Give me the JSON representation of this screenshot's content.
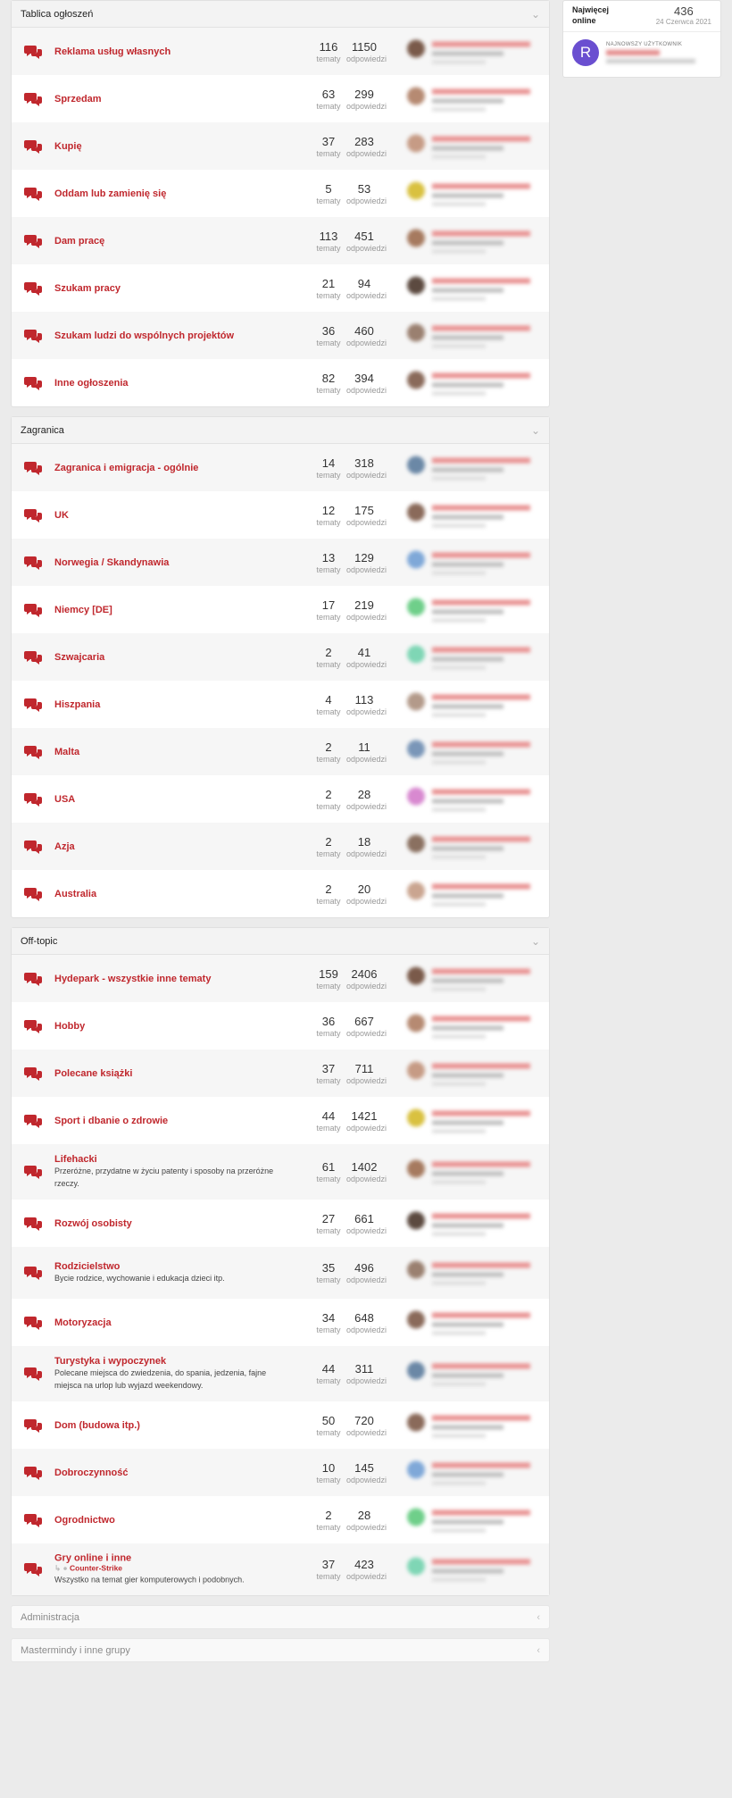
{
  "sidebar": {
    "online_label": "Najwięcej online",
    "online_count": "436",
    "online_date": "24 Czerwca 2021",
    "newest_label": "NAJNOWSZY UŻYTKOWNIK",
    "newest_initial": "R"
  },
  "labels": {
    "topics": "tematy",
    "replies": "odpowiedzi"
  },
  "categories": [
    {
      "title": "Tablica ogłoszeń",
      "forums": [
        {
          "title": "Reklama usług własnych",
          "topics": "116",
          "replies": "1150"
        },
        {
          "title": "Sprzedam",
          "topics": "63",
          "replies": "299"
        },
        {
          "title": "Kupię",
          "topics": "37",
          "replies": "283"
        },
        {
          "title": "Oddam lub zamienię się",
          "topics": "5",
          "replies": "53"
        },
        {
          "title": "Dam pracę",
          "topics": "113",
          "replies": "451"
        },
        {
          "title": "Szukam pracy",
          "topics": "21",
          "replies": "94"
        },
        {
          "title": "Szukam ludzi do wspólnych projektów",
          "topics": "36",
          "replies": "460"
        },
        {
          "title": "Inne ogłoszenia",
          "topics": "82",
          "replies": "394"
        }
      ]
    },
    {
      "title": "Zagranica",
      "forums": [
        {
          "title": "Zagranica i emigracja - ogólnie",
          "topics": "14",
          "replies": "318"
        },
        {
          "title": "UK",
          "topics": "12",
          "replies": "175"
        },
        {
          "title": "Norwegia / Skandynawia",
          "topics": "13",
          "replies": "129"
        },
        {
          "title": "Niemcy [DE]",
          "topics": "17",
          "replies": "219"
        },
        {
          "title": "Szwajcaria",
          "topics": "2",
          "replies": "41"
        },
        {
          "title": "Hiszpania",
          "topics": "4",
          "replies": "113"
        },
        {
          "title": "Malta",
          "topics": "2",
          "replies": "11"
        },
        {
          "title": "USA",
          "topics": "2",
          "replies": "28"
        },
        {
          "title": "Azja",
          "topics": "2",
          "replies": "18"
        },
        {
          "title": "Australia",
          "topics": "2",
          "replies": "20"
        }
      ]
    },
    {
      "title": "Off-topic",
      "forums": [
        {
          "title": "Hydepark - wszystkie inne tematy",
          "topics": "159",
          "replies": "2406"
        },
        {
          "title": "Hobby",
          "topics": "36",
          "replies": "667"
        },
        {
          "title": "Polecane książki",
          "topics": "37",
          "replies": "711"
        },
        {
          "title": "Sport i dbanie o zdrowie",
          "topics": "44",
          "replies": "1421"
        },
        {
          "title": "Lifehacki",
          "desc": "Przeróżne, przydatne w życiu patenty i sposoby na przeróżne rzeczy.",
          "topics": "61",
          "replies": "1402"
        },
        {
          "title": "Rozwój osobisty",
          "topics": "27",
          "replies": "661"
        },
        {
          "title": "Rodzicielstwo",
          "desc": "Bycie rodzice, wychowanie i edukacja dzieci itp.",
          "topics": "35",
          "replies": "496"
        },
        {
          "title": "Motoryzacja",
          "topics": "34",
          "replies": "648"
        },
        {
          "title": "Turystyka i wypoczynek",
          "desc": "Polecane miejsca do zwiedzenia, do spania, jedzenia, fajne miejsca na urlop lub wyjazd weekendowy.",
          "topics": "44",
          "replies": "311"
        },
        {
          "title": "Dom (budowa itp.)",
          "topics": "50",
          "replies": "720"
        },
        {
          "title": "Dobroczynność",
          "topics": "10",
          "replies": "145"
        },
        {
          "title": "Ogrodnictwo",
          "topics": "2",
          "replies": "28"
        },
        {
          "title": "Gry online i inne",
          "sub": "Counter-Strike",
          "desc": "Wszystko na temat gier komputerowych i podobnych.",
          "topics": "37",
          "replies": "423"
        }
      ]
    }
  ],
  "collapsed_categories": [
    "Administracja",
    "Mastermindy i inne grupy"
  ],
  "colors": {
    "accent": "#c0272d",
    "avatar_bg": "#6a4fd0"
  }
}
